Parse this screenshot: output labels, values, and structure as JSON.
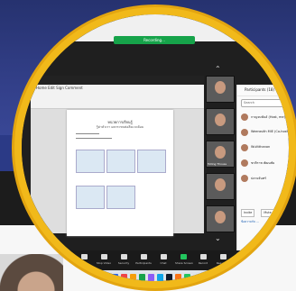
{
  "meeting": {
    "recording_label": "Recording...",
    "toolbar_ribbon": [
      "Home",
      "Edit",
      "Sign",
      "Comment"
    ],
    "doc_title": "หน่วยการเรียนรู้",
    "doc_subtitle": "รู้ค่าตัวเรา ผลกระทบต่อสิ่งแวดล้อม"
  },
  "video_tiles": [
    {
      "name": ""
    },
    {
      "name": ""
    },
    {
      "name": "Tolling Thouss"
    },
    {
      "name": ""
    },
    {
      "name": ""
    }
  ],
  "participants_panel": {
    "title": "Participants (18)",
    "search_placeholder": "Search",
    "participants": [
      {
        "name": "กาญจนพันธ์ (Host, me)"
      },
      {
        "name": "Weerasith MIE (Co-host)"
      },
      {
        "name": "Wulitthanon"
      },
      {
        "name": "ชาติราช พัฒนชัย"
      },
      {
        "name": "ปลายจันทร์"
      }
    ],
    "buttons": [
      "Invite",
      "Mute All",
      "..."
    ],
    "chat_preview": "ข้อความกับ ..."
  },
  "toolbar": {
    "buttons": [
      "Mute",
      "Stop Video",
      "Security",
      "Participants",
      "Chat",
      "Share Screen",
      "Record",
      "Reactions"
    ],
    "end_label": "End"
  },
  "colors": {
    "ring": "#f1b91a",
    "background_top": "#2b3a86",
    "end_button": "#e02424",
    "recording": "#16a34a"
  }
}
